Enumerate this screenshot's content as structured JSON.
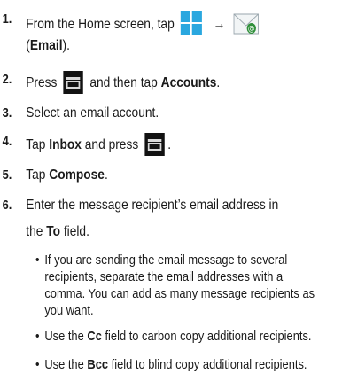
{
  "steps": [
    {
      "num": "1.",
      "pre": "From the Home screen, tap",
      "post_open": "(",
      "post_bold": "Email",
      "post_close": ")."
    },
    {
      "num": "2.",
      "pre": "Press",
      "mid": "and then tap",
      "bold": "Accounts",
      "end": "."
    },
    {
      "num": "3.",
      "text": "Select an email account."
    },
    {
      "num": "4.",
      "pre": "Tap",
      "bold": "Inbox",
      "mid": "and press",
      "end": "."
    },
    {
      "num": "5.",
      "pre": "Tap",
      "bold": "Compose",
      "end": "."
    },
    {
      "num": "6.",
      "line1": "Enter the message recipient’s email address in",
      "pre2": "the",
      "bold2": "To",
      "post2": "field."
    }
  ],
  "bullets": [
    {
      "lines": [
        "If you are sending the email message to several",
        "recipients, separate the email addresses with a",
        "comma. You can add as many message recipients as",
        "you want."
      ]
    },
    {
      "pre": "Use the",
      "bold": "Cc",
      "post": "field to carbon copy additional recipients."
    },
    {
      "pre": "Use the",
      "bold": "Bcc",
      "post": "field to blind copy additional recipients."
    }
  ],
  "icons": {
    "home": "apps-grid-icon",
    "email": "email-envelope-icon",
    "menu": "menu-key-icon",
    "arrow": "→"
  },
  "colors": {
    "apps_blue": "#2aa7df",
    "menu_black": "#121212"
  }
}
